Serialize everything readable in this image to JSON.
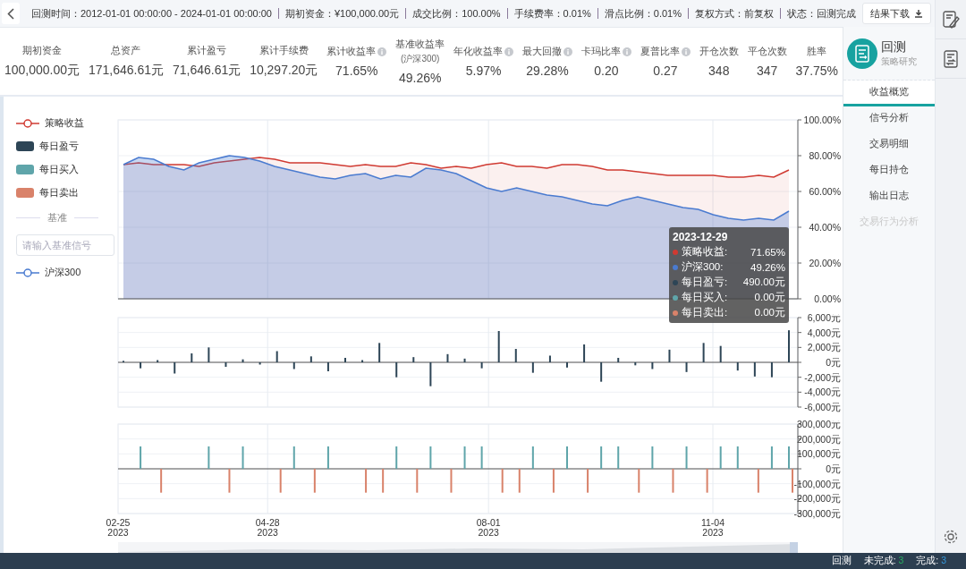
{
  "top_bar": {
    "items": [
      "回测时间：2012-01-01 00:00:00 - 2024-01-01 00:00:00",
      "期初资金：¥100,000.00元",
      "成交比例：100.00%",
      "手续费率：0.01%",
      "滑点比例：0.01%",
      "复权方式：前复权",
      "状态：回测完成"
    ],
    "download_button": "结果下载"
  },
  "stats": [
    {
      "label": "期初资金",
      "info": false,
      "value": "100,000.00元"
    },
    {
      "label": "总资产",
      "info": false,
      "value": "171,646.61元"
    },
    {
      "label": "累计盈亏",
      "info": false,
      "value": "71,646.61元"
    },
    {
      "label": "累计手续费",
      "info": false,
      "value": "10,297.20元"
    },
    {
      "label": "累计收益率",
      "info": true,
      "value": "71.65%"
    },
    {
      "label": "基准收益率",
      "sublabel": "(沪深300)",
      "info": false,
      "value": "49.26%"
    },
    {
      "label": "年化收益率",
      "info": true,
      "value": "5.97%"
    },
    {
      "label": "最大回撤",
      "info": true,
      "value": "29.28%"
    },
    {
      "label": "卡玛比率",
      "info": true,
      "value": "0.20"
    },
    {
      "label": "夏普比率",
      "info": true,
      "value": "0.27"
    },
    {
      "label": "开仓次数",
      "info": false,
      "value": "348"
    },
    {
      "label": "平仓次数",
      "info": false,
      "value": "347"
    },
    {
      "label": "胜率",
      "info": false,
      "value": "37.75%"
    }
  ],
  "legend": [
    {
      "kind": "line"
    },
    {
      "kind": "box"
    },
    {
      "kind": "box"
    },
    {
      "kind": "box"
    }
  ],
  "benchmark": {
    "title": "基准",
    "placeholder": "请输入基准信号",
    "items": [
      {
        "kind": "line"
      }
    ]
  },
  "charts": [
    {
      "chart_data": {
        "type": "area",
        "grid": true,
        "ylim": [
          0,
          100
        ],
        "yticks": [
          {
            "value": 0,
            "label": "0.00%"
          },
          {
            "value": 20,
            "label": "20.00%"
          },
          {
            "value": 40,
            "label": "40.00%"
          },
          {
            "value": 60,
            "label": "60.00%"
          },
          {
            "value": 80,
            "label": "80.00%"
          },
          {
            "value": 100,
            "label": "100.00%"
          }
        ],
        "series": [
          {
            "name": "策略收益",
            "color": "#d03a32",
            "values": [
              75,
              76,
              75,
              75,
              75,
              74,
              76,
              77,
              78,
              79,
              78,
              76,
              76,
              76,
              75,
              74,
              75,
              74,
              74,
              76,
              75,
              73,
              74,
              73,
              75,
              76,
              74,
              74,
              73,
              75,
              75,
              74,
              72,
              72,
              71,
              70,
              69,
              69,
              69,
              69,
              68,
              68,
              69,
              68,
              72
            ]
          },
          {
            "name": "沪深300",
            "color": "#4a7bd0",
            "values": [
              75,
              79,
              78,
              74,
              72,
              76,
              78,
              80,
              79,
              77,
              74,
              72,
              70,
              68,
              67,
              69,
              70,
              67,
              69,
              68,
              73,
              72,
              70,
              66,
              62,
              60,
              62,
              60,
              58,
              57,
              55,
              53,
              52,
              55,
              57,
              55,
              53,
              51,
              50,
              47,
              45,
              44,
              45,
              44,
              49
            ]
          }
        ]
      }
    },
    {
      "chart_data": {
        "type": "bar",
        "grid": true,
        "ylim": [
          -6000,
          6000
        ],
        "yticks": [
          {
            "value": -6000,
            "label": "-6,000元"
          },
          {
            "value": -4000,
            "label": "-4,000元"
          },
          {
            "value": -2000,
            "label": "-2,000元"
          },
          {
            "value": 0,
            "label": "0元"
          },
          {
            "value": 2000,
            "label": "2,000元"
          },
          {
            "value": 4000,
            "label": "4,000元"
          },
          {
            "value": 6000,
            "label": "6,000元"
          }
        ],
        "series": [
          {
            "name": "每日盈亏",
            "color": "#2d4556",
            "values": [
              200,
              -800,
              300,
              -1500,
              1200,
              2000,
              -600,
              400,
              -300,
              1500,
              -900,
              800,
              -1200,
              600,
              300,
              2600,
              -2000,
              700,
              -3200,
              1100,
              500,
              -800,
              4200,
              1800,
              -1400,
              900,
              -700,
              2400,
              -2600,
              600,
              -400,
              -900,
              1700,
              -1300,
              2600,
              2200,
              -1100,
              -1900,
              -2000,
              4300
            ]
          }
        ]
      }
    },
    {
      "chart_data": {
        "type": "bar",
        "grid": true,
        "ylim": [
          -300000,
          300000
        ],
        "yticks": [
          {
            "value": -300000,
            "label": "-300,000元"
          },
          {
            "value": -200000,
            "label": "-200,000元"
          },
          {
            "value": -100000,
            "label": "-100,000元"
          },
          {
            "value": 0,
            "label": "0元"
          },
          {
            "value": 100000,
            "label": "100,000元"
          },
          {
            "value": 200000,
            "label": "200,000元"
          },
          {
            "value": 300000,
            "label": "300,000元"
          }
        ],
        "series": [
          {
            "name": "每日买入",
            "color": "#5fa5aa",
            "values": [
              0,
              150000,
              0,
              0,
              0,
              150000,
              0,
              150000,
              0,
              0,
              150000,
              0,
              150000,
              0,
              0,
              0,
              150000,
              0,
              150000,
              0,
              150000,
              150000,
              0,
              0,
              150000,
              0,
              150000,
              0,
              150000,
              150000,
              0,
              150000,
              0,
              150000,
              0,
              150000,
              150000,
              0,
              150000,
              150000
            ]
          },
          {
            "name": "每日卖出",
            "color": "#d9826a",
            "values": [
              0,
              0,
              -160000,
              0,
              0,
              0,
              -160000,
              0,
              0,
              -160000,
              0,
              -160000,
              0,
              0,
              -160000,
              -160000,
              0,
              -160000,
              0,
              -160000,
              0,
              0,
              -160000,
              -160000,
              0,
              -160000,
              0,
              -160000,
              0,
              0,
              -160000,
              0,
              -160000,
              0,
              -160000,
              0,
              0,
              -160000,
              0,
              -160000
            ]
          }
        ]
      },
      "x_axis_labels": [
        {
          "date": "02-25",
          "year": "2023"
        },
        {
          "date": "04-28",
          "year": "2023"
        },
        {
          "date": "08-01",
          "year": "2023"
        },
        {
          "date": "11-04",
          "year": "2023"
        }
      ]
    }
  ],
  "tooltip": {
    "date": "2023-12-29",
    "rows": [
      {
        "label": "策略收益:",
        "value": "71.65%",
        "color": "#d03a32"
      },
      {
        "label": "沪深300:",
        "value": "49.26%",
        "color": "#4a7bd0"
      },
      {
        "label": "每日盈亏:",
        "value": "490.00元",
        "color": "#2d4556"
      },
      {
        "label": "每日买入:",
        "value": "0.00元",
        "color": "#5fa5aa"
      },
      {
        "label": "每日卖出:",
        "value": "0.00元",
        "color": "#d9826a"
      }
    ]
  },
  "app": {
    "title": "回测",
    "subtitle": "策略研究"
  },
  "nav": [
    {
      "label": "收益概览",
      "selected": true,
      "disabled": false
    },
    {
      "label": "信号分析",
      "selected": false,
      "disabled": false
    },
    {
      "label": "交易明细",
      "selected": false,
      "disabled": false
    },
    {
      "label": "每日持仓",
      "selected": false,
      "disabled": false
    },
    {
      "label": "输出日志",
      "selected": false,
      "disabled": false
    },
    {
      "label": "交易行为分析",
      "selected": false,
      "disabled": true
    }
  ],
  "status_bar": {
    "title": "回测",
    "counts": [
      {
        "label": "未完成:",
        "value": "3",
        "color": "#27ae60"
      },
      {
        "label": "完成:",
        "value": "3",
        "color": "#3498db"
      }
    ]
  }
}
